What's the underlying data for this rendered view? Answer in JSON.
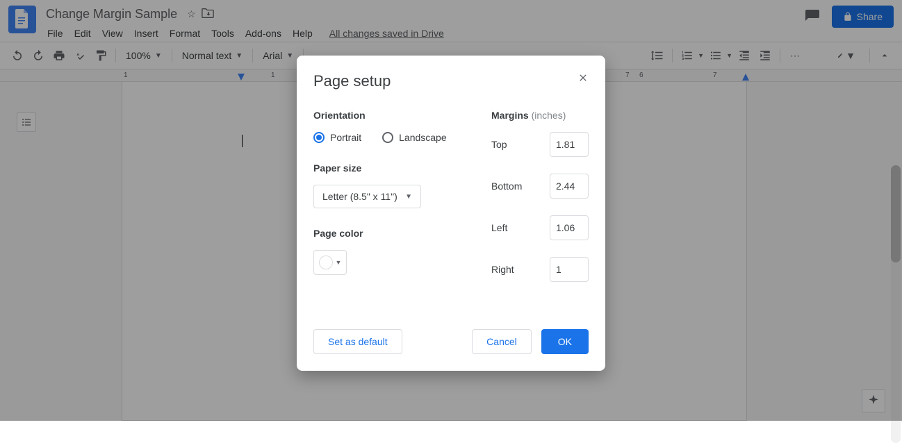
{
  "header": {
    "doc_title": "Change Margin Sample",
    "menus": [
      "File",
      "Edit",
      "View",
      "Insert",
      "Format",
      "Tools",
      "Add-ons",
      "Help"
    ],
    "save_status": "All changes saved in Drive",
    "share_label": "Share"
  },
  "toolbar": {
    "zoom": "100%",
    "style": "Normal text",
    "font": "Arial"
  },
  "ruler": {
    "marks": [
      "1",
      "1",
      "7",
      "6",
      "7"
    ]
  },
  "dialog": {
    "title": "Page setup",
    "orientation_label": "Orientation",
    "orientation_portrait": "Portrait",
    "orientation_landscape": "Landscape",
    "paper_size_label": "Paper size",
    "paper_size_value": "Letter (8.5\" x 11\")",
    "page_color_label": "Page color",
    "margins_label": "Margins",
    "margins_unit": "(inches)",
    "margin_top_label": "Top",
    "margin_top_value": "1.81",
    "margin_bottom_label": "Bottom",
    "margin_bottom_value": "2.44",
    "margin_left_label": "Left",
    "margin_left_value": "1.06",
    "margin_right_label": "Right",
    "margin_right_value": "1",
    "set_default_label": "Set as default",
    "cancel_label": "Cancel",
    "ok_label": "OK"
  }
}
